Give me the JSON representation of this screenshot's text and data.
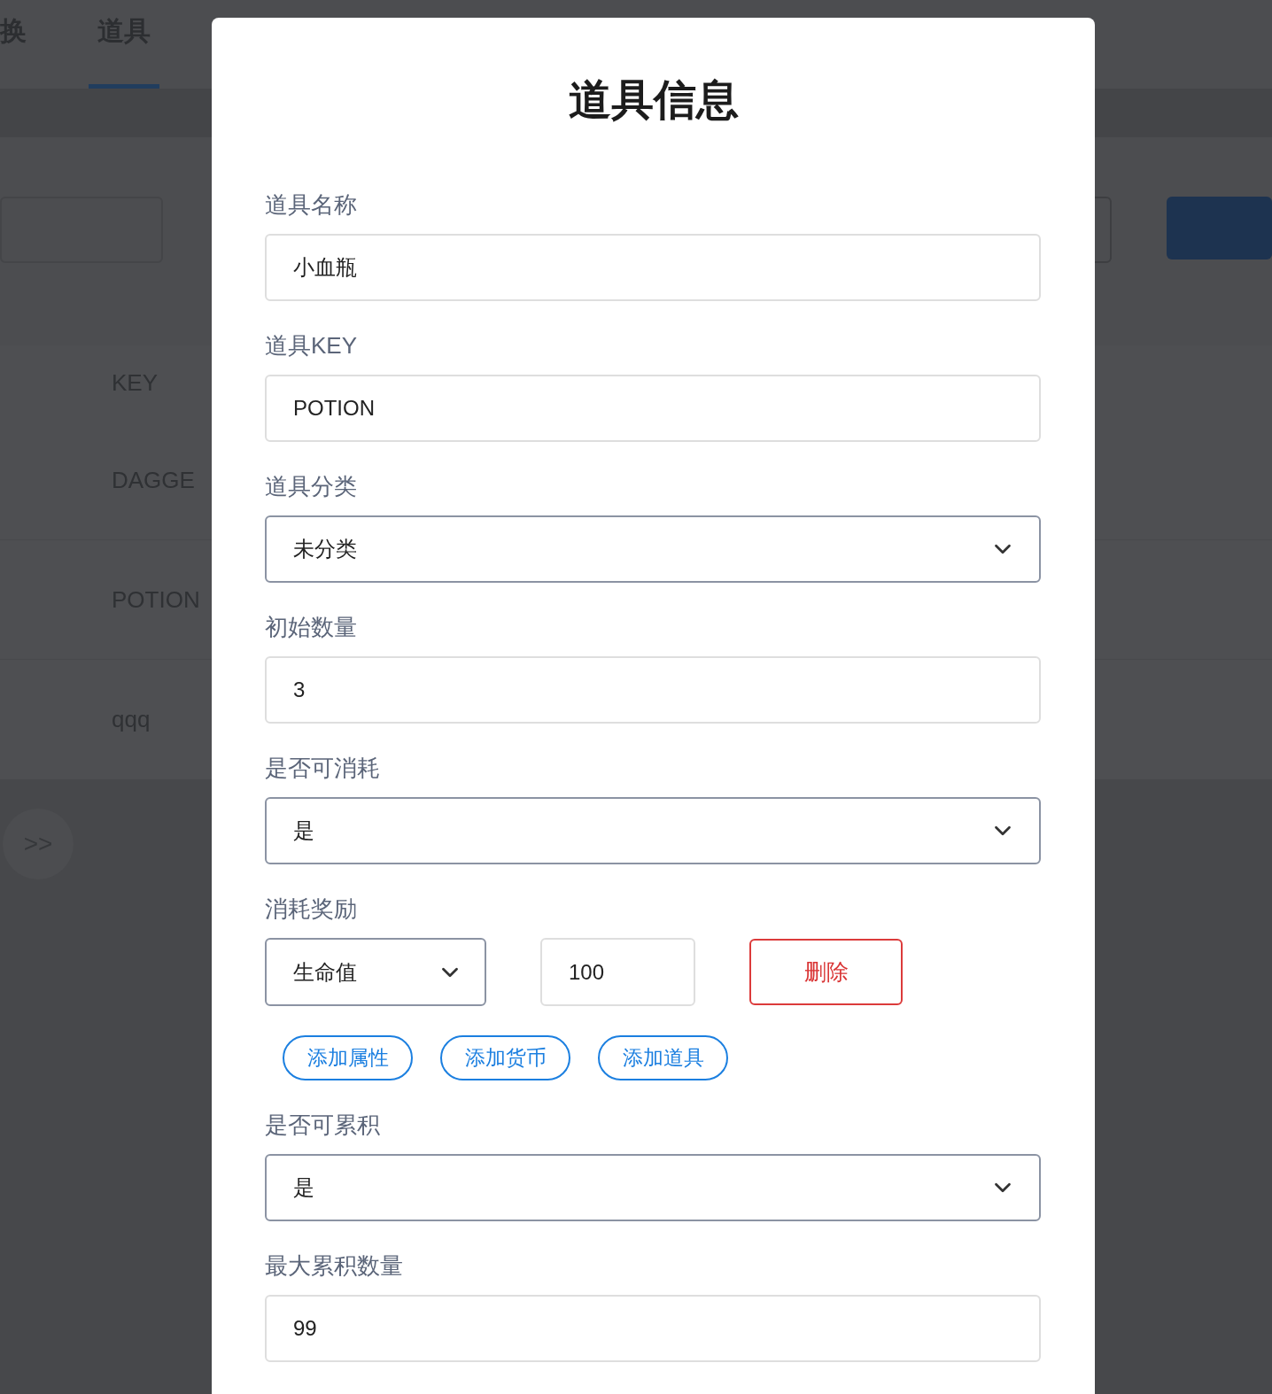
{
  "background": {
    "tabs": [
      {
        "label": "换",
        "selected": false
      },
      {
        "label": "道具",
        "selected": true
      }
    ],
    "table": {
      "column": "KEY",
      "rows": [
        "DAGGE",
        "POTION",
        "qqq"
      ]
    },
    "expand_button": ">>"
  },
  "dialog": {
    "title": "道具信息",
    "fields": [
      {
        "kind": "text",
        "label": "道具名称",
        "value": "小血瓶"
      },
      {
        "kind": "text",
        "label": "道具KEY",
        "value": "POTION"
      },
      {
        "kind": "select",
        "label": "道具分类",
        "value": "未分类"
      },
      {
        "kind": "text",
        "label": "初始数量",
        "value": "3"
      },
      {
        "kind": "select",
        "label": "是否可消耗",
        "value": "是"
      },
      {
        "kind": "rewards",
        "label": "消耗奖励",
        "rewards": [
          {
            "type": "生命值",
            "amount": "100",
            "delete": "删除"
          }
        ],
        "add_buttons": [
          "添加属性",
          "添加货币",
          "添加道具"
        ]
      },
      {
        "kind": "select",
        "label": "是否可累积",
        "value": "是"
      },
      {
        "kind": "text",
        "label": "最大累积数量",
        "value": "99"
      }
    ]
  }
}
